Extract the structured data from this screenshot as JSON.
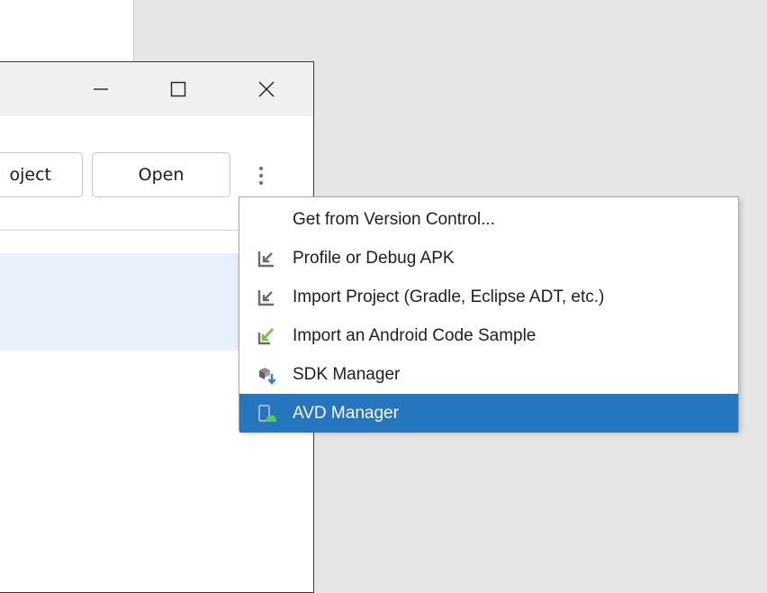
{
  "window": {
    "controls": {
      "minimize": "minimize",
      "maximize": "maximize",
      "close": "close"
    }
  },
  "toolbar": {
    "new_project_label": "oject",
    "open_label": "Open",
    "more_icon": "more-vertical-icon"
  },
  "menu": {
    "items": [
      {
        "label": "Get from Version Control...",
        "icon": ""
      },
      {
        "label": "Profile or Debug APK",
        "icon": "import-arrow-icon"
      },
      {
        "label": "Import Project (Gradle, Eclipse ADT, etc.)",
        "icon": "import-arrow-icon"
      },
      {
        "label": "Import an Android Code Sample",
        "icon": "import-sample-icon"
      },
      {
        "label": "SDK Manager",
        "icon": "sdk-manager-icon"
      },
      {
        "label": "AVD Manager",
        "icon": "avd-manager-icon",
        "selected": true
      }
    ]
  },
  "colors": {
    "selection": "#2675bf",
    "project_row_highlight": "#e7f0fb",
    "background": "#e6e6e6"
  }
}
